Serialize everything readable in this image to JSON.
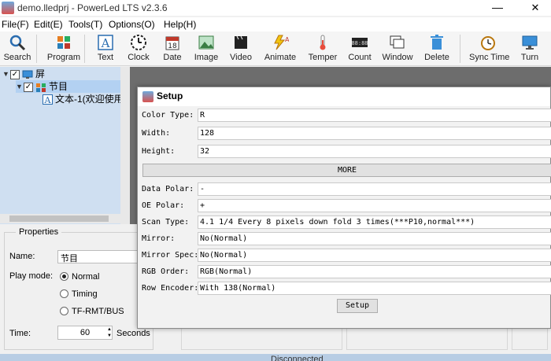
{
  "window": {
    "title": "demo.lledprj - PowerLed LTS v2.3.6",
    "minimize_glyph": "—",
    "close_glyph": "✕"
  },
  "menu": [
    "File(F)",
    "Edit(E)",
    "Tools(T)",
    "Options(O)",
    "Help(H)"
  ],
  "toolbar": [
    {
      "label": "Search",
      "icon": "search-icon"
    },
    {
      "label": "Program",
      "icon": "program-icon"
    },
    {
      "label": "Text",
      "icon": "text-icon"
    },
    {
      "label": "Clock",
      "icon": "clock-icon"
    },
    {
      "label": "Date",
      "icon": "calendar-icon"
    },
    {
      "label": "Image",
      "icon": "image-icon"
    },
    {
      "label": "Video",
      "icon": "video-icon"
    },
    {
      "label": "Animate",
      "icon": "animate-icon"
    },
    {
      "label": "Temper",
      "icon": "thermometer-icon"
    },
    {
      "label": "Count",
      "icon": "counter-icon"
    },
    {
      "label": "Window",
      "icon": "window-icon"
    },
    {
      "label": "Delete",
      "icon": "trash-icon"
    },
    {
      "label": "Sync Time",
      "icon": "sync-time-icon"
    },
    {
      "label": "Turn",
      "icon": "monitor-icon"
    }
  ],
  "tree": {
    "screen": "屏",
    "program": "节目",
    "text_item": "文本-1(欢迎使用"
  },
  "properties": {
    "title": "Properties",
    "name_label": "Name:",
    "name_value": "节目",
    "play_mode_label": "Play mode:",
    "modes": [
      "Normal",
      "Timing",
      "TF-RMT/BUS"
    ],
    "time_label": "Time:",
    "time_value": "60",
    "time_unit": "Seconds"
  },
  "status": {
    "text": "Disconnected"
  },
  "dialog": {
    "title": "Setup",
    "color_type_label": "Color Type:",
    "color_type": "R",
    "width_label": "Width:",
    "width": "128",
    "height_label": "Height:",
    "height": "32",
    "more_label": "MORE",
    "data_polar_label": "Data Polar:",
    "data_polar": "-",
    "oe_polar_label": "OE Polar:",
    "oe_polar": "+",
    "scan_type_label": "Scan Type:",
    "scan_type": "4.1  1/4 Every 8 pixels down fold 3 times(***P10,normal***)",
    "mirror_label": "Mirror:",
    "mirror": "No(Normal)",
    "mirror_spec_label": "Mirror Spec:",
    "mirror_spec": "No(Normal)",
    "rgb_order_label": "RGB Order:",
    "rgb_order": "RGB(Normal)",
    "row_encoder_label": "Row Encoder:",
    "row_encoder": "With 138(Normal)",
    "setup_button": "Setup"
  }
}
